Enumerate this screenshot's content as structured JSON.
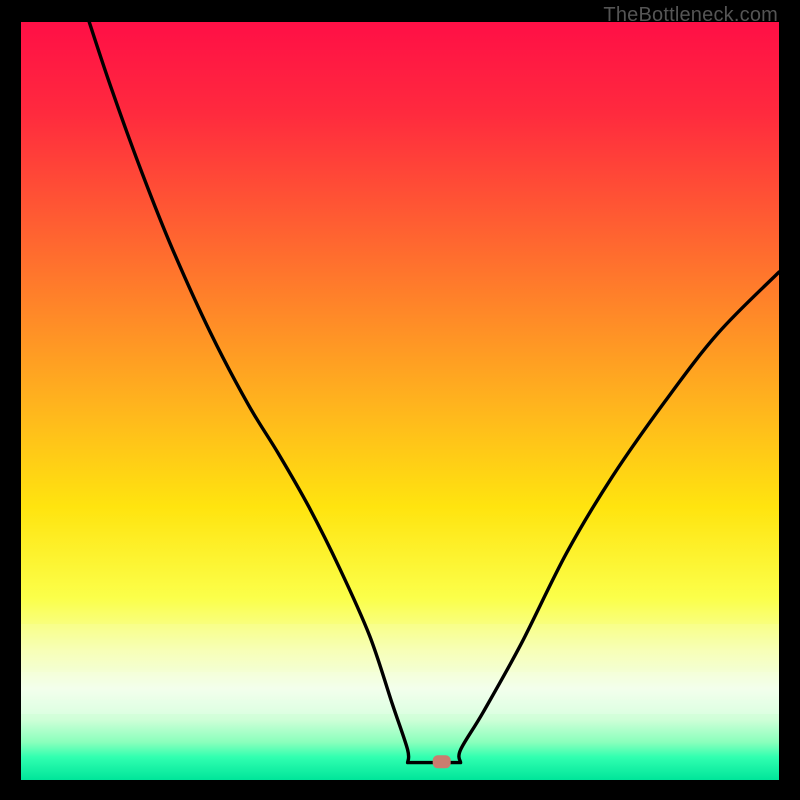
{
  "watermark": "TheBottleneck.com",
  "marker": {
    "cx_pct": 55.5,
    "cy_pct": 97.6,
    "fill": "#c97d6f"
  },
  "chart_data": {
    "type": "line",
    "title": "",
    "xlabel": "",
    "ylabel": "",
    "xlim": [
      0,
      100
    ],
    "ylim": [
      0,
      100
    ],
    "gradient_stops": [
      {
        "pct": 0,
        "color": "#ff0f46"
      },
      {
        "pct": 12,
        "color": "#ff2a3e"
      },
      {
        "pct": 30,
        "color": "#ff6a2f"
      },
      {
        "pct": 50,
        "color": "#ffb21e"
      },
      {
        "pct": 64,
        "color": "#ffe40f"
      },
      {
        "pct": 76,
        "color": "#fbff4a"
      },
      {
        "pct": 83,
        "color": "#f6ffb0"
      },
      {
        "pct": 88,
        "color": "#f0ffe8"
      },
      {
        "pct": 92,
        "color": "#cfffd8"
      },
      {
        "pct": 95,
        "color": "#8affbc"
      },
      {
        "pct": 97,
        "color": "#30ffb0"
      },
      {
        "pct": 100,
        "color": "#00e59a"
      }
    ],
    "series": [
      {
        "name": "bottleneck-curve",
        "x": [
          9,
          12,
          16,
          20,
          25,
          30,
          34,
          38,
          42,
          46,
          49,
          51,
          53,
          55,
          58,
          61,
          66,
          72,
          78,
          85,
          92,
          100
        ],
        "y": [
          100,
          91,
          80,
          70,
          59,
          49.5,
          43,
          36,
          28,
          19,
          10,
          4,
          2.3,
          2.3,
          4,
          9,
          18,
          30,
          40,
          50,
          59,
          67
        ]
      }
    ],
    "flat_bottom": {
      "x_from_pct": 51,
      "x_to_pct": 58,
      "y_pct": 97.7
    },
    "marker_point": {
      "x": 55.5,
      "y": 2.4
    }
  }
}
